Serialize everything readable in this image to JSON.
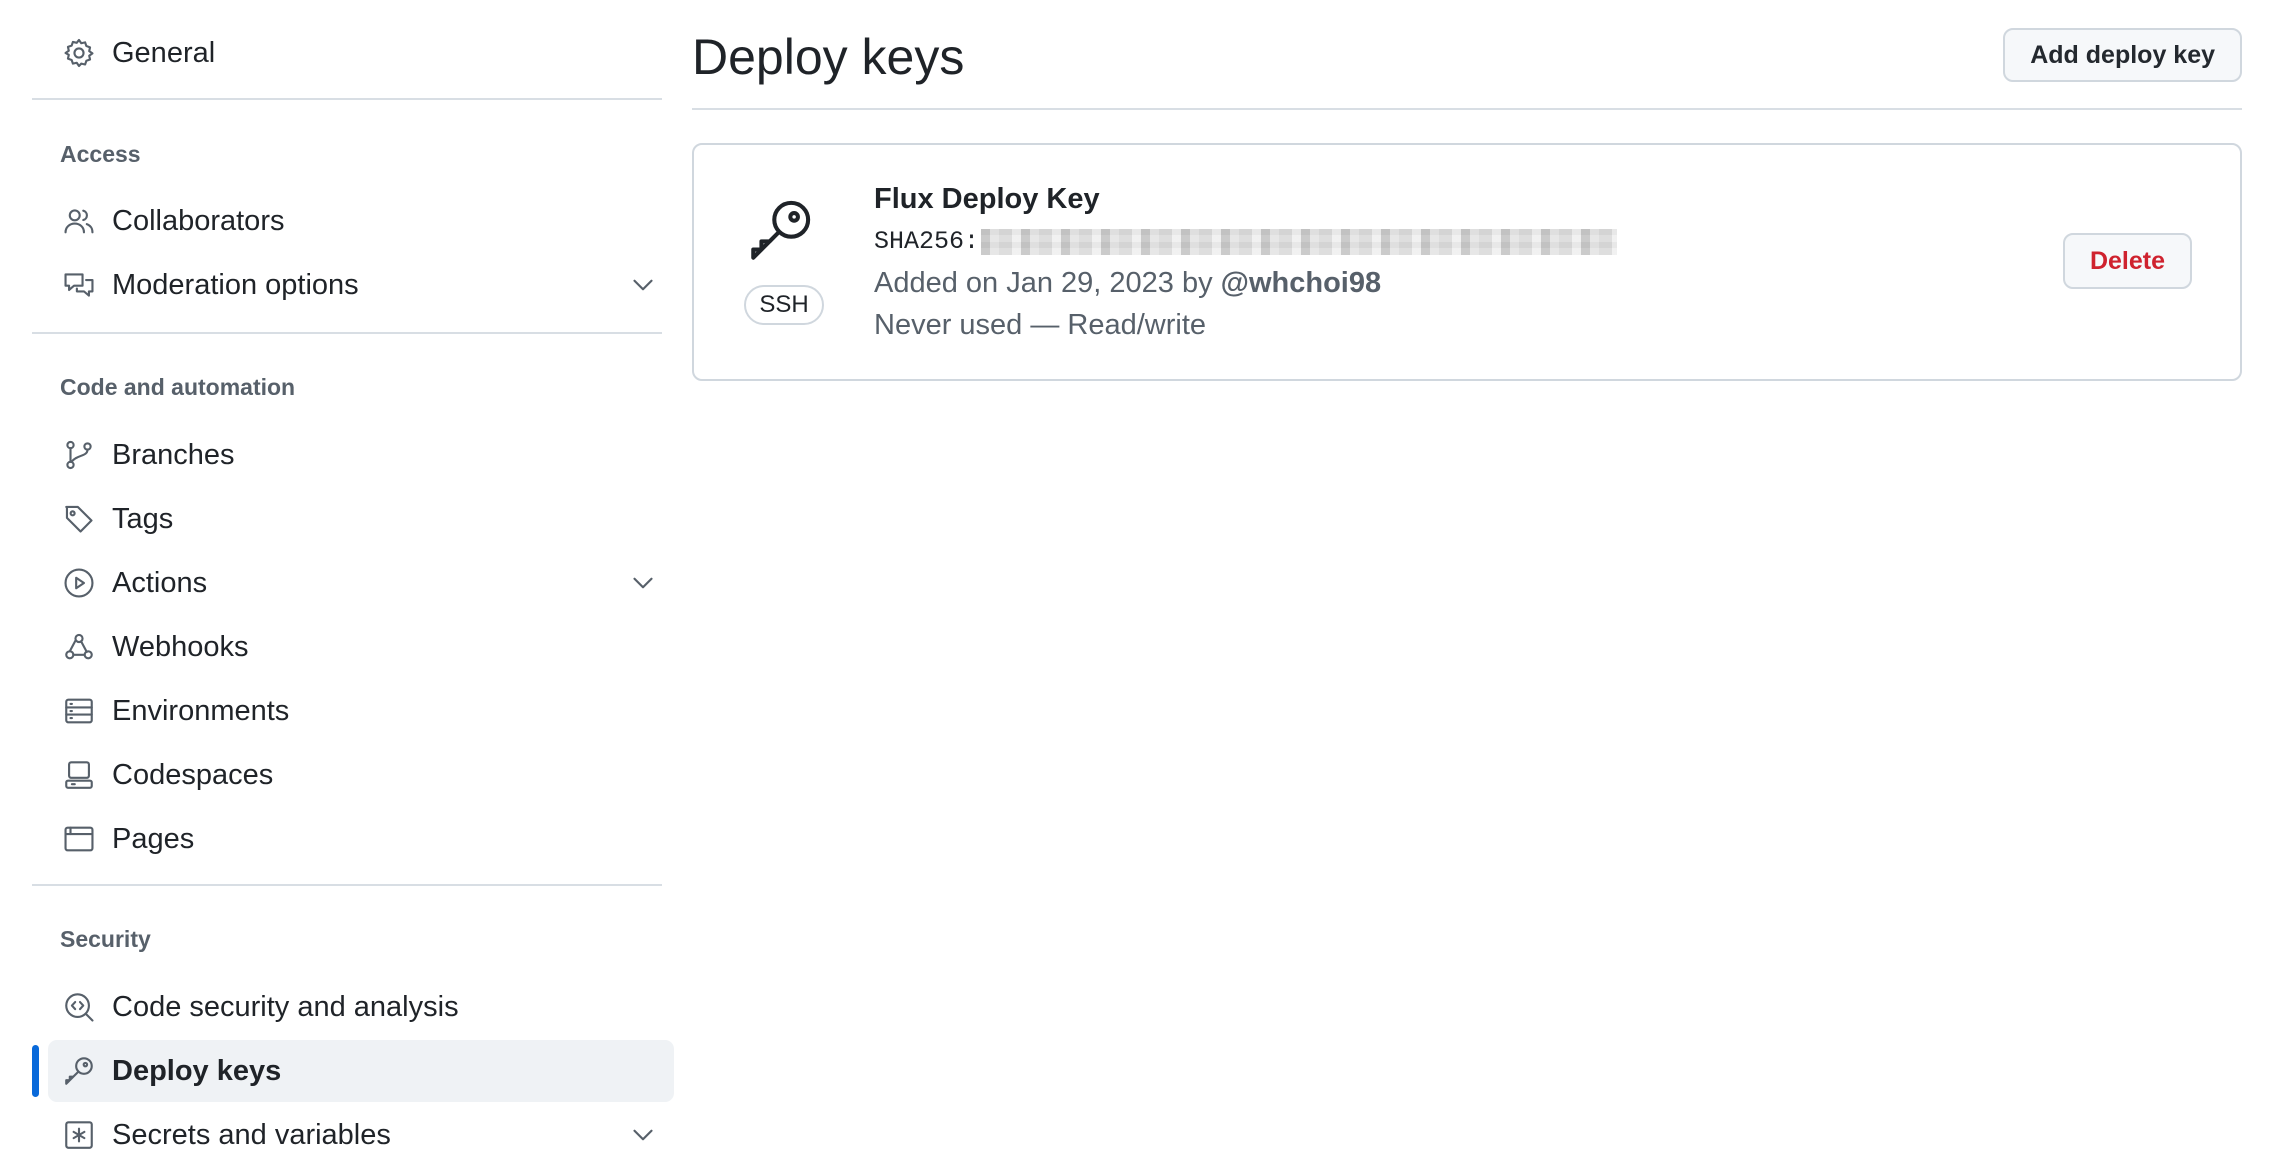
{
  "sidebar": {
    "general": {
      "label": "General",
      "icon": "gear-icon"
    },
    "groups": {
      "access": {
        "title": "Access",
        "items": [
          {
            "label": "Collaborators",
            "icon": "people-icon"
          },
          {
            "label": "Moderation options",
            "icon": "comment-discussion-icon",
            "expandable": true
          }
        ]
      },
      "code": {
        "title": "Code and automation",
        "items": [
          {
            "label": "Branches",
            "icon": "git-branch-icon"
          },
          {
            "label": "Tags",
            "icon": "tag-icon"
          },
          {
            "label": "Actions",
            "icon": "play-icon",
            "expandable": true
          },
          {
            "label": "Webhooks",
            "icon": "webhook-icon"
          },
          {
            "label": "Environments",
            "icon": "server-icon"
          },
          {
            "label": "Codespaces",
            "icon": "codespaces-icon"
          },
          {
            "label": "Pages",
            "icon": "browser-icon"
          }
        ]
      },
      "security": {
        "title": "Security",
        "items": [
          {
            "label": "Code security and analysis",
            "icon": "codescan-icon"
          },
          {
            "label": "Deploy keys",
            "icon": "key-icon",
            "active": true
          },
          {
            "label": "Secrets and variables",
            "icon": "key-asterisk-icon",
            "expandable": true
          }
        ]
      }
    }
  },
  "main": {
    "title": "Deploy keys",
    "add_button": "Add deploy key",
    "key": {
      "name": "Flux Deploy Key",
      "type_badge": "SSH",
      "fingerprint_prefix": "SHA256:",
      "added_prefix": "Added on Jan 29, 2023 by ",
      "added_by": "@whchoi98",
      "usage": "Never used — Read/write",
      "delete_label": "Delete"
    }
  },
  "colors": {
    "accent": "#0969da",
    "danger": "#cf222e",
    "muted_text": "#57606a",
    "border": "#d0d7de",
    "active_bg": "#eff2f5"
  }
}
